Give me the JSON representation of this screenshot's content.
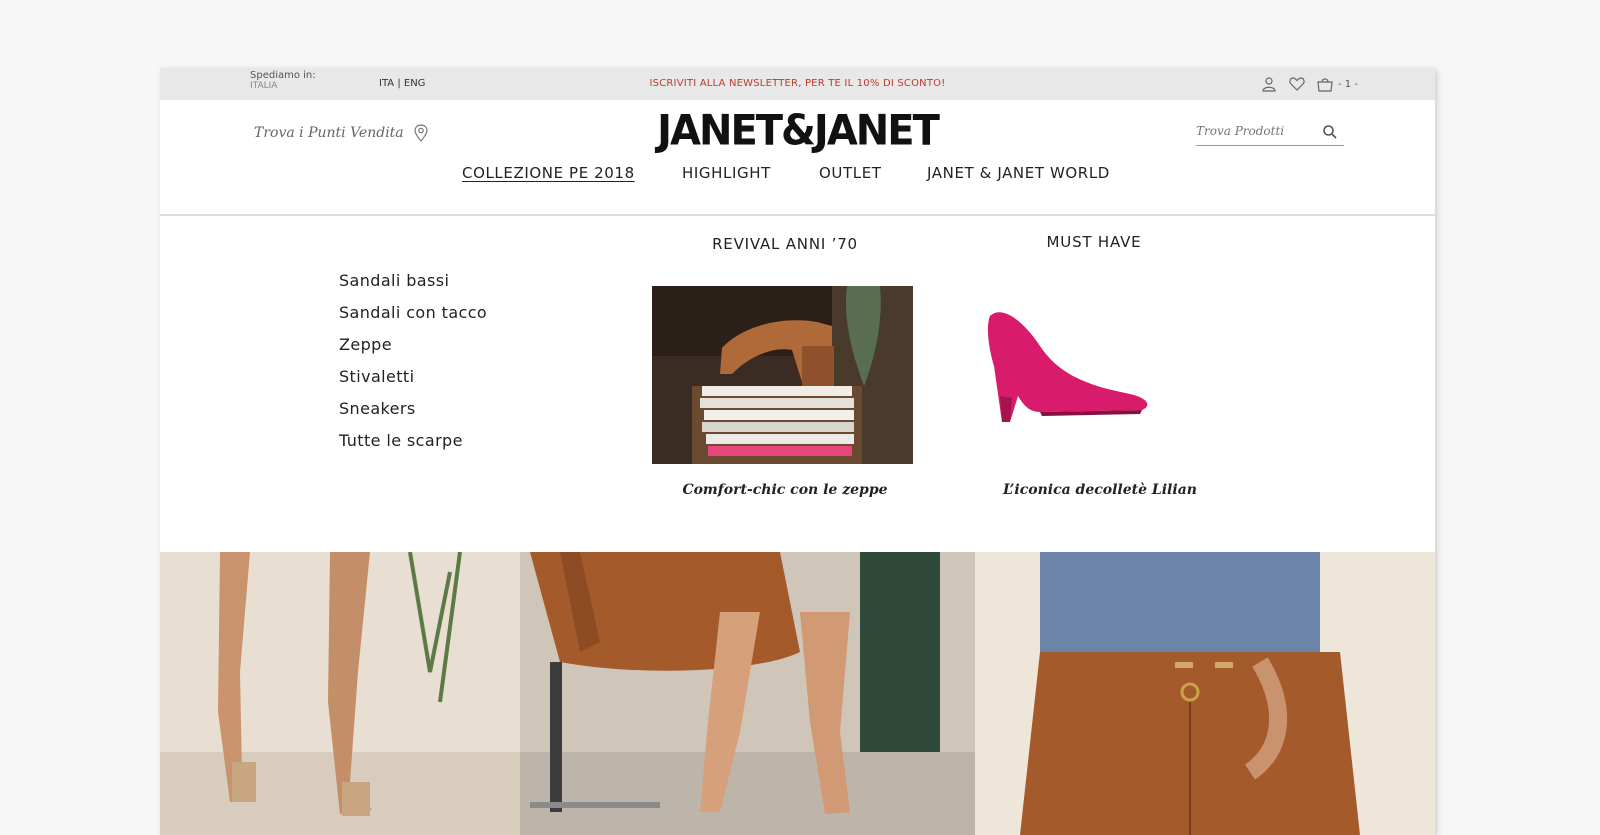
{
  "topbar": {
    "ship_label": "Spediamo in:",
    "ship_country": "ITALIA",
    "lang_ita": "ITA",
    "lang_sep": "|",
    "lang_eng": "ENG",
    "newsletter": "ISCRIVITI ALLA NEWSLETTER, PER TE IL 10% DI SCONTO!",
    "cart_count": "- 1 -"
  },
  "header": {
    "stores_label": "Trova i Punti Vendita",
    "logo": "JANET&JANET",
    "search_placeholder": "Trova Prodotti"
  },
  "nav": {
    "items": [
      {
        "label": "COLLEZIONE PE 2018"
      },
      {
        "label": "HIGHLIGHT"
      },
      {
        "label": "OUTLET"
      },
      {
        "label": "JANET & JANET WORLD"
      }
    ]
  },
  "menu": {
    "items": [
      {
        "label": "Sandali bassi"
      },
      {
        "label": "Sandali con tacco"
      },
      {
        "label": "Zeppe"
      },
      {
        "label": "Stivaletti"
      },
      {
        "label": "Sneakers"
      },
      {
        "label": "Tutte le scarpe"
      }
    ],
    "promo1": {
      "title": "REVIVAL ANNI ’70",
      "caption": "Comfort-chic con le zeppe"
    },
    "promo2": {
      "title": "MUST HAVE",
      "caption": "L’iconica decolletè Lilian"
    }
  },
  "colors": {
    "newsletter": "#c0392b",
    "topbar_bg": "#e8e8e8",
    "shoe_pink": "#d81b6a",
    "suede_brown": "#a0562c"
  },
  "icons": [
    "map-pin-icon",
    "user-icon",
    "heart-icon",
    "cart-icon",
    "search-icon"
  ]
}
